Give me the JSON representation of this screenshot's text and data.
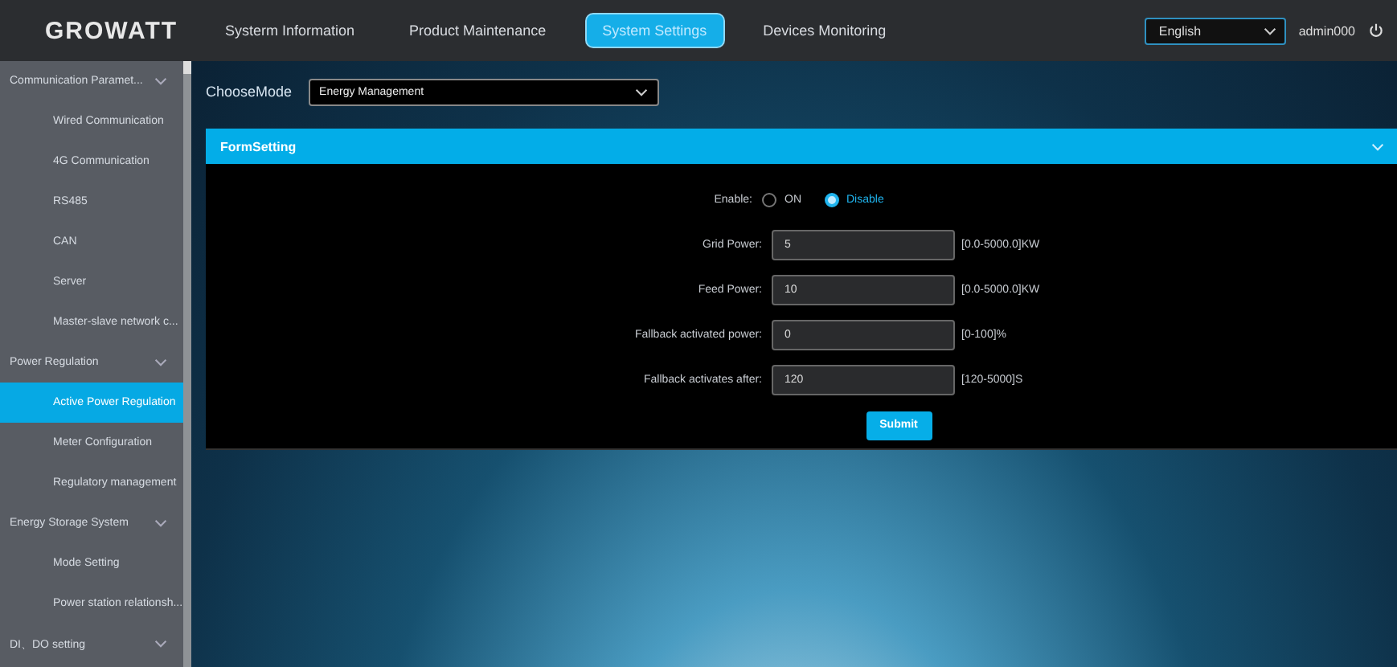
{
  "header": {
    "logo": "GROWATT",
    "nav": [
      {
        "label": "Systerm Information",
        "selected": false
      },
      {
        "label": "Product Maintenance",
        "selected": false
      },
      {
        "label": "System Settings",
        "selected": true
      },
      {
        "label": "Devices Monitoring",
        "selected": false
      }
    ],
    "language": {
      "value": "English"
    },
    "user": "admin000"
  },
  "sidebar": {
    "items": [
      {
        "label": "Communication Paramet...",
        "expanded": true,
        "children": [
          {
            "label": "Wired Communication",
            "selected": false
          },
          {
            "label": "4G Communication",
            "selected": false
          },
          {
            "label": "RS485",
            "selected": false
          },
          {
            "label": "CAN",
            "selected": false
          },
          {
            "label": "Server",
            "selected": false
          },
          {
            "label": "Master-slave network c...",
            "selected": false
          }
        ]
      },
      {
        "label": "Power Regulation",
        "expanded": true,
        "children": [
          {
            "label": "Active Power Regulation",
            "selected": true
          },
          {
            "label": "Meter Configuration",
            "selected": false
          },
          {
            "label": "Regulatory management",
            "selected": false
          }
        ]
      },
      {
        "label": "Energy Storage System",
        "expanded": true,
        "children": [
          {
            "label": "Mode Setting",
            "selected": false
          },
          {
            "label": "Power station relationsh...",
            "selected": false
          }
        ]
      },
      {
        "label": "DI、DO setting",
        "expanded": true
      }
    ]
  },
  "mode": {
    "label": "ChooseMode",
    "value": "Energy Management"
  },
  "form": {
    "title": "FormSetting",
    "expanded": true,
    "enable": {
      "label": "Enable:",
      "options": [
        {
          "label": "ON",
          "selected": false
        },
        {
          "label": "Disable",
          "selected": true
        }
      ]
    },
    "fields": [
      {
        "label": "Grid Power:",
        "value": "5",
        "range": "[0.0-5000.0]KW"
      },
      {
        "label": "Feed Power:",
        "value": "10",
        "range": "[0.0-5000.0]KW"
      },
      {
        "label": "Fallback activated power:",
        "value": "0",
        "range": "[0-100]%"
      },
      {
        "label": "Fallback activates after:",
        "value": "120",
        "range": "[120-5000]S"
      }
    ],
    "submit": "Submit"
  }
}
